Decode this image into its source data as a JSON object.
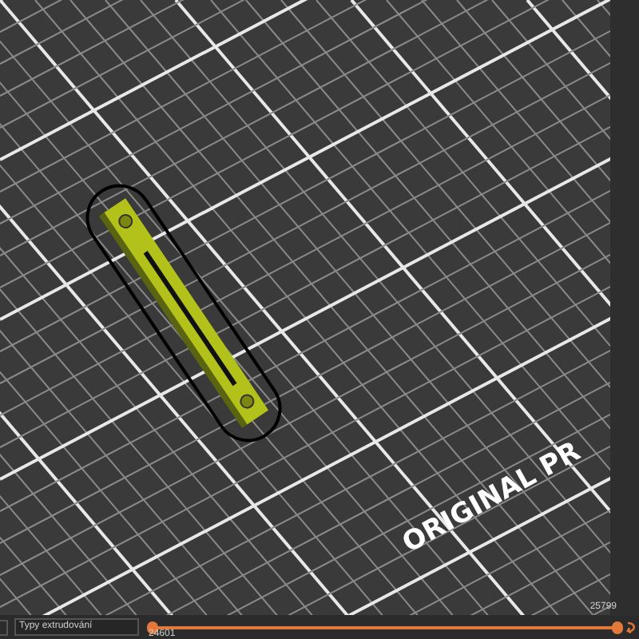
{
  "viewport": {
    "bed_label": "ORIGINAL PR"
  },
  "bottom_bar": {
    "view_type": "Typy extrudování",
    "upper_value": "25799",
    "lower_value": "24601"
  }
}
